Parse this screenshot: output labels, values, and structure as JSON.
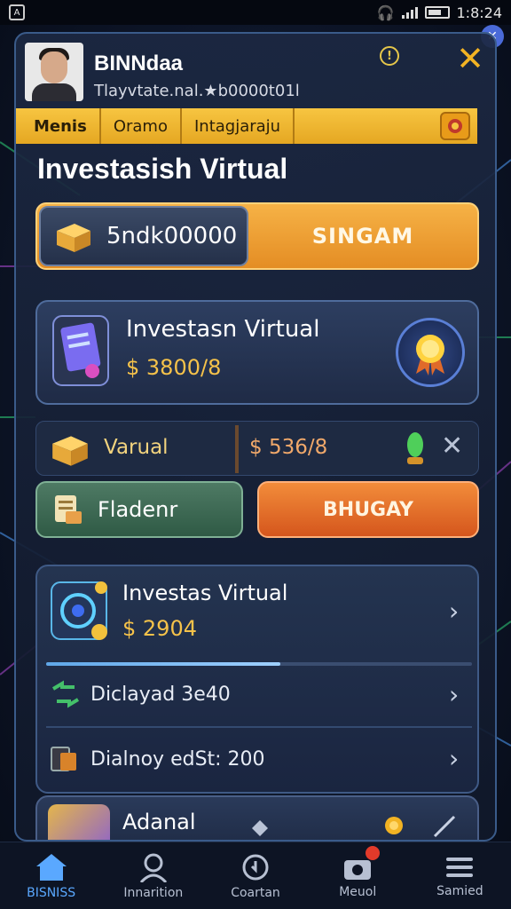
{
  "status": {
    "time": "1:8:24"
  },
  "profile": {
    "name": "BINNdaa",
    "subtitle": "Tlayvtate.nal.★b0000t01l"
  },
  "header": {
    "tabs": [
      "Menis",
      "Oramo",
      "Intagjaraju"
    ]
  },
  "page": {
    "title": "Investasish Virtual"
  },
  "balance": {
    "amount": "5ndk00000",
    "button": "SINGAM"
  },
  "investment_card": {
    "title": "Investasn Virtual",
    "value": "$ 3800/8"
  },
  "row": {
    "label": "Varual",
    "value": "$ 536/8"
  },
  "buttons": {
    "left": "Fladenr",
    "right": "BHUGAY"
  },
  "panel": {
    "title": "Investas Virtual",
    "value": "$ 2904",
    "progress": 0.55,
    "items": [
      {
        "label": "Diclayad 3e40"
      },
      {
        "label": "Dialnoy edSt: 200"
      }
    ]
  },
  "bottom_card": {
    "title": "Adanal"
  },
  "nav": [
    {
      "label": "BISNISS",
      "icon": "home-icon",
      "active": true
    },
    {
      "label": "Innarition",
      "icon": "user-icon",
      "active": false
    },
    {
      "label": "Coartan",
      "icon": "refresh-icon",
      "active": false
    },
    {
      "label": "Meuol",
      "icon": "camera-icon",
      "active": false
    },
    {
      "label": "Samied",
      "icon": "menu-icon",
      "active": false
    }
  ],
  "colors": {
    "accent": "#f7c541",
    "primary_orange": "#e48d24",
    "nav_active": "#5aa8ff"
  }
}
